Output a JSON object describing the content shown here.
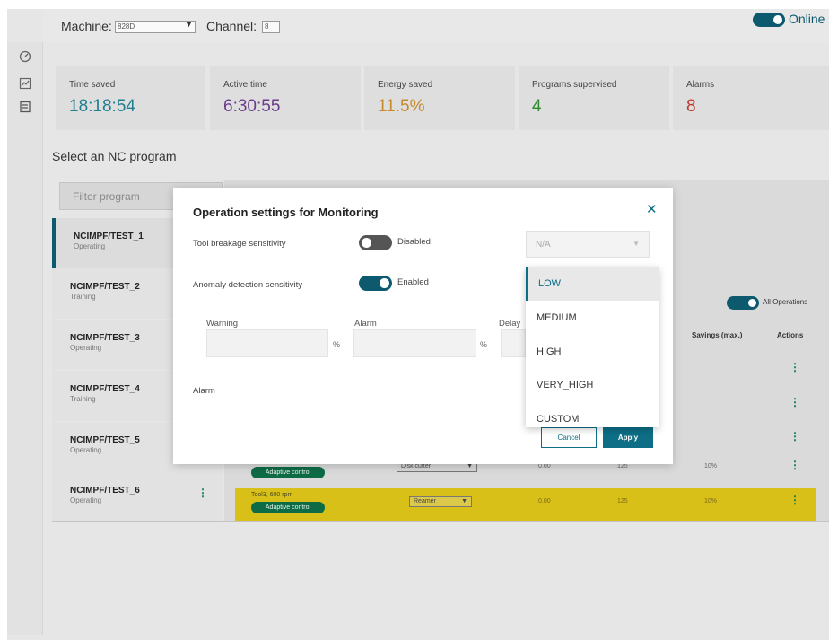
{
  "header": {
    "machine_label": "Machine:",
    "machine_value": "828D",
    "channel_label": "Channel:",
    "channel_value": "8",
    "online_label": "Online"
  },
  "stats": [
    {
      "label": "Time saved",
      "value": "18:18:54",
      "color": "#1f7f8f"
    },
    {
      "label": "Active time",
      "value": "6:30:55",
      "color": "#6a3b8a"
    },
    {
      "label": "Energy saved",
      "value": "11.5%",
      "color": "#c8892c"
    },
    {
      "label": "Programs supervised",
      "value": "4",
      "color": "#2f8a2f"
    },
    {
      "label": "Alarms",
      "value": "8",
      "color": "#c0392b"
    }
  ],
  "section_title": "Select an NC program",
  "filter_placeholder": "Filter program",
  "programs": [
    {
      "name": "NCIMPF/TEST_1",
      "status": "Operating"
    },
    {
      "name": "NCIMPF/TEST_2",
      "status": "Training"
    },
    {
      "name": "NCIMPF/TEST_3",
      "status": "Operating"
    },
    {
      "name": "NCIMPF/TEST_4",
      "status": "Training"
    },
    {
      "name": "NCIMPF/TEST_5",
      "status": "Operating"
    },
    {
      "name": "NCIMPF/TEST_6",
      "status": "Operating"
    }
  ],
  "table": {
    "all_operations_label": "All Operations",
    "headers": {
      "savings": "Savings (max.)",
      "actions": "Actions"
    },
    "rows": [
      {
        "tool": "",
        "adaptive": "Adaptive control",
        "cutter": "Disk cutter",
        "v1": "0.00",
        "v2": "125",
        "v3": "10%"
      },
      {
        "tool": "Tool3, 600 rpm",
        "adaptive": "Adaptive control",
        "cutter": "Reamer",
        "v1": "0.00",
        "v2": "125",
        "v3": "10%"
      }
    ]
  },
  "modal": {
    "title": "Operation settings for Monitoring",
    "tool_breakage_label": "Tool breakage sensitivity",
    "tool_breakage_state": "Disabled",
    "anomaly_label": "Anomaly detection sensitivity",
    "anomaly_state": "Enabled",
    "na_value": "N/A",
    "warning_label": "Warning",
    "alarm_field_label": "Alarm",
    "delay_label": "Delay",
    "percent": "%",
    "alarm_row_label": "Alarm",
    "cancel_label": "Cancel",
    "apply_label": "Apply"
  },
  "dropdown": {
    "options": [
      "LOW",
      "MEDIUM",
      "HIGH",
      "VERY_HIGH",
      "CUSTOM"
    ],
    "selected": "LOW"
  }
}
